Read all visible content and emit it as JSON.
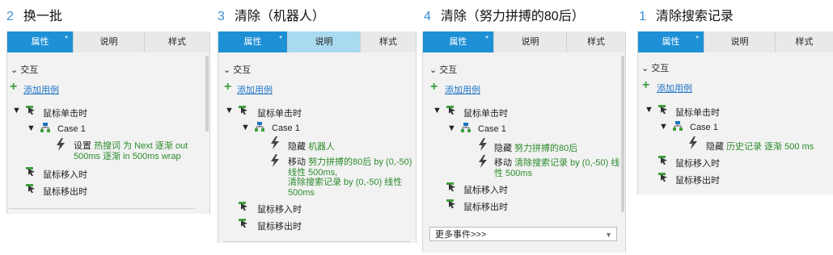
{
  "panels": [
    {
      "number": "2",
      "title": "换一批",
      "tabs": [
        "属性",
        "说明",
        "样式"
      ],
      "section": "交互",
      "add_case": "添加用例",
      "event_click": "鼠标单击时",
      "case": "Case 1",
      "actions": [
        {
          "verb": "设置",
          "detail_lines": [
            "热搜词 为 Next 逐渐 out",
            "500ms 逐渐 in 500ms wrap"
          ]
        }
      ],
      "event_enter": "鼠标移入时",
      "event_leave": "鼠标移出时"
    },
    {
      "number": "3",
      "title": "清除（机器人）",
      "tabs": [
        "属性",
        "说明",
        "样式"
      ],
      "section": "交互",
      "add_case": "添加用例",
      "event_click": "鼠标单击时",
      "case": "Case 1",
      "actions": [
        {
          "verb": "隐藏",
          "detail_lines": [
            "机器人"
          ]
        },
        {
          "verb": "移动",
          "detail_lines": [
            "努力拼搏的80后 by (0,-50)",
            "线性 500ms,",
            "清除搜索记录 by (0,-50) 线性",
            "500ms"
          ]
        }
      ],
      "event_enter": "鼠标移入时",
      "event_leave": "鼠标移出时"
    },
    {
      "number": "4",
      "title": "清除（努力拼搏的80后）",
      "tabs": [
        "属性",
        "说明",
        "样式"
      ],
      "section": "交互",
      "add_case": "添加用例",
      "event_click": "鼠标单击时",
      "case": "Case 1",
      "actions": [
        {
          "verb": "隐藏",
          "detail_lines": [
            "努力拼搏的80后"
          ]
        },
        {
          "verb": "移动",
          "detail_lines": [
            "清除搜索记录 by (0,-50) 线",
            "性 500ms"
          ]
        }
      ],
      "event_enter": "鼠标移入时",
      "event_leave": "鼠标移出时",
      "more_events": "更多事件>>>"
    },
    {
      "number": "1",
      "title": "清除搜索记录",
      "tabs": [
        "属性",
        "说明",
        "样式"
      ],
      "section": "交互",
      "add_case": "添加用例",
      "event_click": "鼠标单击时",
      "case": "Case 1",
      "actions": [
        {
          "verb": "隐藏",
          "detail_lines": [
            "历史记录 逐渐 500 ms"
          ]
        }
      ],
      "event_enter": "鼠标移入时",
      "event_leave": "鼠标移出时"
    }
  ]
}
